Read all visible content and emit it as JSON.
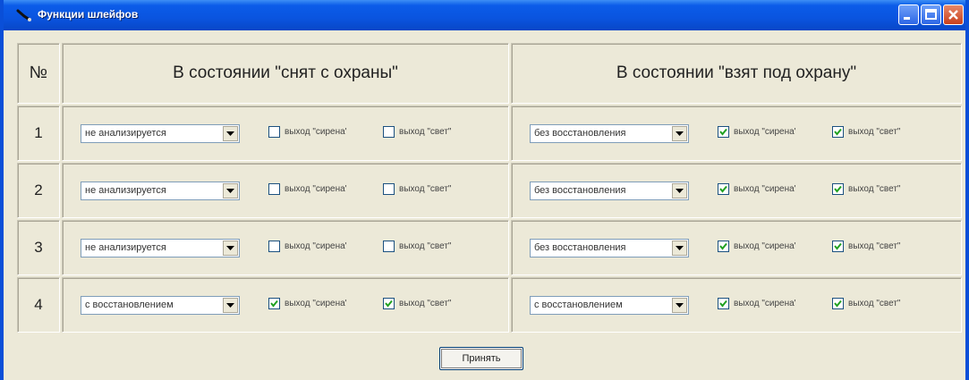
{
  "window": {
    "title": "Функции шлейфов"
  },
  "table": {
    "headers": {
      "num": "№",
      "disarmed": "В состоянии \"снят с охраны\"",
      "armed": "В состоянии \"взят под охрану\""
    },
    "rows": [
      {
        "num": "1",
        "disarmed": {
          "mode": "не анализируется",
          "siren": false,
          "siren_label": "выход \"сирена'",
          "light": false,
          "light_label": "выход \"свет\""
        },
        "armed": {
          "mode": "без восстановления",
          "siren": true,
          "siren_label": "выход \"сирена'",
          "light": true,
          "light_label": "выход \"свет\""
        }
      },
      {
        "num": "2",
        "disarmed": {
          "mode": "не анализируется",
          "siren": false,
          "siren_label": "выход \"сирена'",
          "light": false,
          "light_label": "выход \"свет\""
        },
        "armed": {
          "mode": "без восстановления",
          "siren": true,
          "siren_label": "выход \"сирена'",
          "light": true,
          "light_label": "выход \"свет\""
        }
      },
      {
        "num": "3",
        "disarmed": {
          "mode": "не анализируется",
          "siren": false,
          "siren_label": "выход \"сирена'",
          "light": false,
          "light_label": "выход \"свет\""
        },
        "armed": {
          "mode": "без восстановления",
          "siren": true,
          "siren_label": "выход \"сирена'",
          "light": true,
          "light_label": "выход \"свет\""
        }
      },
      {
        "num": "4",
        "disarmed": {
          "mode": "с восстановлением",
          "siren": true,
          "siren_label": "выход \"сирена'",
          "light": true,
          "light_label": "выход \"свет\""
        },
        "armed": {
          "mode": "с восстановлением",
          "siren": true,
          "siren_label": "выход \"сирена'",
          "light": true,
          "light_label": "выход \"свет\""
        }
      }
    ]
  },
  "footer": {
    "apply_label": "Принять"
  },
  "colors": {
    "titlebar": "#0a54df",
    "window_bg": "#ece9d8",
    "close_button": "#c8401c"
  },
  "icons": {
    "title": "loop-wire-icon",
    "minimize": "minimize-icon",
    "maximize": "maximize-icon",
    "close": "close-icon",
    "combo_arrow": "chevron-down-icon",
    "check": "checkmark-icon"
  }
}
